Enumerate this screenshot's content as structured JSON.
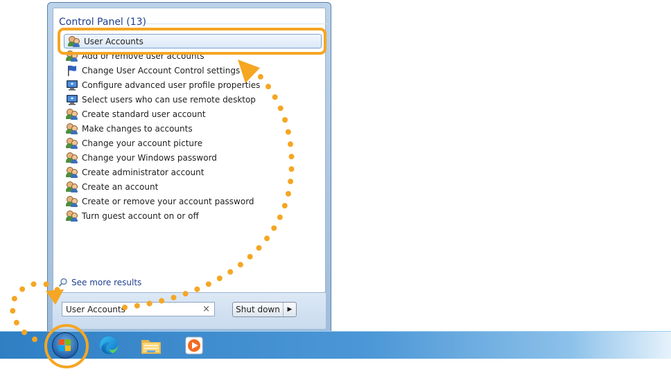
{
  "start_menu": {
    "group_header": "Control Panel (13)",
    "results": [
      {
        "label": "User Accounts",
        "icon": "users-icon",
        "highlighted": true
      },
      {
        "label": "Add or remove user accounts",
        "icon": "users-icon"
      },
      {
        "label": "Change User Account Control settings",
        "icon": "flag-icon"
      },
      {
        "label": "Configure advanced user profile properties",
        "icon": "monitor-icon"
      },
      {
        "label": "Select users who can use remote desktop",
        "icon": "monitor-icon"
      },
      {
        "label": "Create standard user account",
        "icon": "users-icon"
      },
      {
        "label": "Make changes to accounts",
        "icon": "users-icon"
      },
      {
        "label": "Change your account picture",
        "icon": "users-icon"
      },
      {
        "label": "Change your Windows password",
        "icon": "users-icon"
      },
      {
        "label": "Create administrator account",
        "icon": "users-icon"
      },
      {
        "label": "Create an account",
        "icon": "users-icon"
      },
      {
        "label": "Create or remove your account password",
        "icon": "users-icon"
      },
      {
        "label": "Turn guest account on or off",
        "icon": "users-icon"
      }
    ],
    "see_more": "See more results",
    "search": {
      "value": "User Accounts",
      "clear_icon": "close-icon"
    },
    "shutdown": {
      "label": "Shut down",
      "arrow_icon": "chevron-right-icon"
    }
  },
  "taskbar": {
    "items": [
      "start-orb",
      "edge-icon",
      "file-explorer-icon",
      "media-player-icon"
    ]
  },
  "annotation": {
    "accent_color": "#f5a623"
  }
}
